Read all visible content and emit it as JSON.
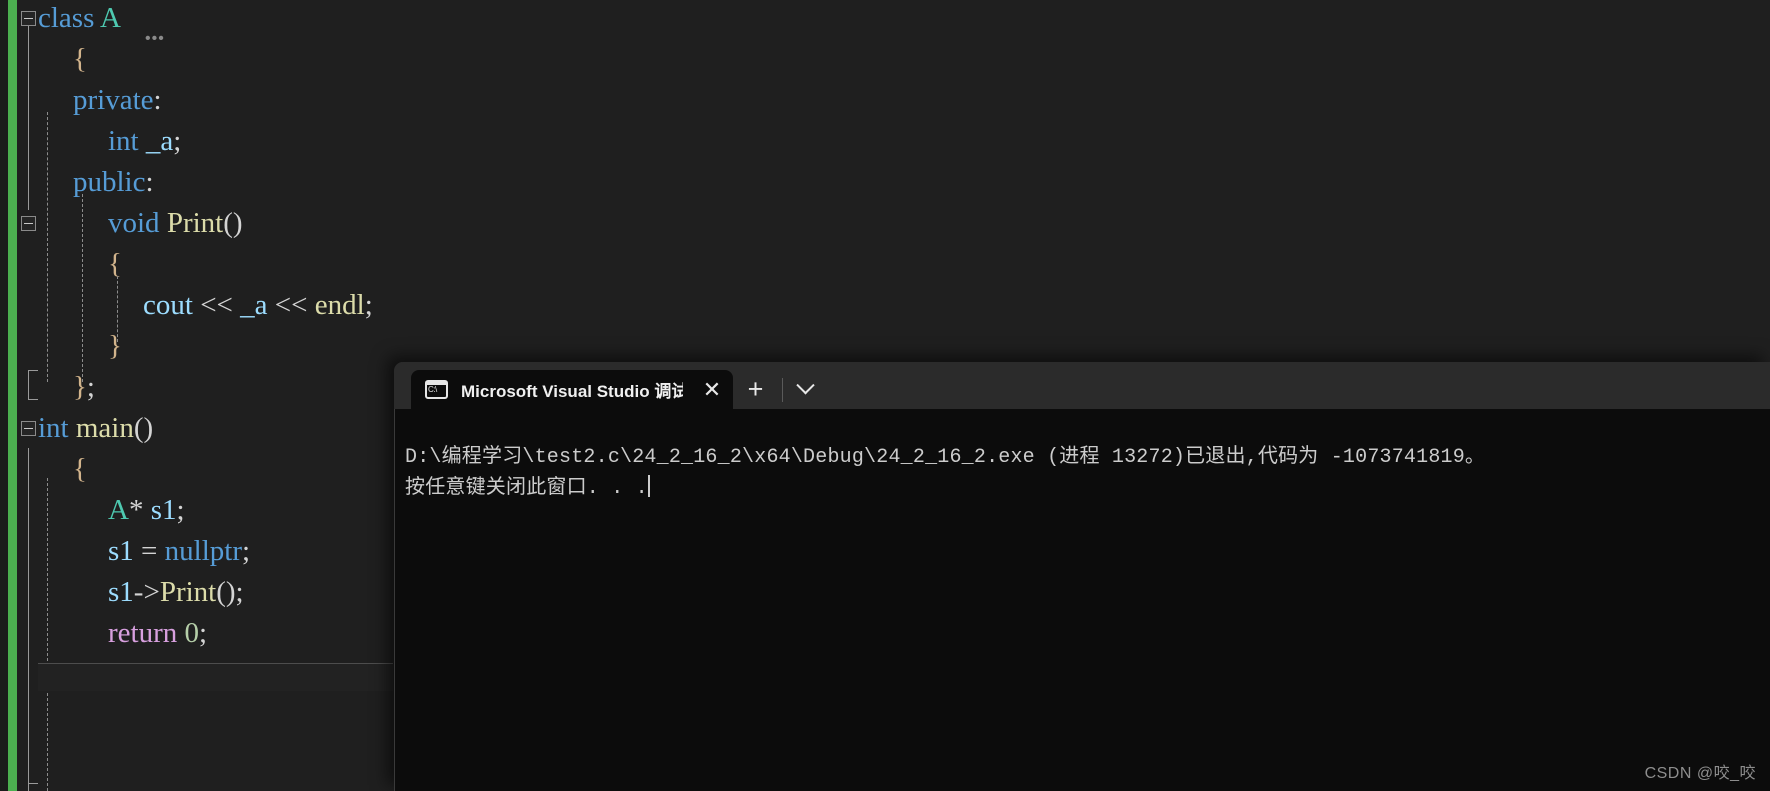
{
  "editor": {
    "language": "cpp",
    "change_bar_color": "#4caf50",
    "background": "#1f1f1f",
    "lines": [
      {
        "indent": 0,
        "fold": true,
        "tokens": [
          {
            "t": "class",
            "c": "kw"
          },
          {
            "t": " ",
            "c": "plain"
          },
          {
            "t": "A",
            "c": "type"
          }
        ]
      },
      {
        "indent": 1,
        "fold": false,
        "tokens": [
          {
            "t": "{",
            "c": "brace"
          }
        ]
      },
      {
        "indent": 1,
        "fold": false,
        "tokens": [
          {
            "t": "private",
            "c": "kw"
          },
          {
            "t": ":",
            "c": "punct"
          }
        ]
      },
      {
        "indent": 2,
        "fold": false,
        "tokens": [
          {
            "t": "int",
            "c": "kw"
          },
          {
            "t": " ",
            "c": "plain"
          },
          {
            "t": "_a",
            "c": "var"
          },
          {
            "t": ";",
            "c": "punct"
          }
        ]
      },
      {
        "indent": 1,
        "fold": false,
        "tokens": [
          {
            "t": "public",
            "c": "kw"
          },
          {
            "t": ":",
            "c": "punct"
          }
        ]
      },
      {
        "indent": 2,
        "fold": true,
        "tokens": [
          {
            "t": "void",
            "c": "kw"
          },
          {
            "t": " ",
            "c": "plain"
          },
          {
            "t": "Print",
            "c": "fn"
          },
          {
            "t": "()",
            "c": "punct"
          }
        ]
      },
      {
        "indent": 2,
        "fold": false,
        "tokens": [
          {
            "t": "{",
            "c": "brace"
          }
        ]
      },
      {
        "indent": 3,
        "fold": false,
        "tokens": [
          {
            "t": "cout",
            "c": "var"
          },
          {
            "t": " ",
            "c": "plain"
          },
          {
            "t": "<<",
            "c": "op"
          },
          {
            "t": " ",
            "c": "plain"
          },
          {
            "t": "_a",
            "c": "var"
          },
          {
            "t": " ",
            "c": "plain"
          },
          {
            "t": "<<",
            "c": "op"
          },
          {
            "t": " ",
            "c": "plain"
          },
          {
            "t": "endl",
            "c": "fn"
          },
          {
            "t": ";",
            "c": "punct"
          }
        ]
      },
      {
        "indent": 2,
        "fold": false,
        "tokens": [
          {
            "t": "}",
            "c": "brace"
          }
        ]
      },
      {
        "indent": 1,
        "fold": false,
        "tokens": [
          {
            "t": "}",
            "c": "brace"
          },
          {
            "t": ";",
            "c": "punct"
          }
        ]
      },
      {
        "indent": 0,
        "fold": true,
        "tokens": [
          {
            "t": "int",
            "c": "kw"
          },
          {
            "t": " ",
            "c": "plain"
          },
          {
            "t": "main",
            "c": "fn"
          },
          {
            "t": "()",
            "c": "punct"
          }
        ]
      },
      {
        "indent": 1,
        "fold": false,
        "tokens": [
          {
            "t": "{",
            "c": "brace"
          }
        ]
      },
      {
        "indent": 2,
        "fold": false,
        "tokens": [
          {
            "t": "A",
            "c": "type"
          },
          {
            "t": "*",
            "c": "plain"
          },
          {
            "t": " ",
            "c": "plain"
          },
          {
            "t": "s1",
            "c": "var"
          },
          {
            "t": ";",
            "c": "punct"
          }
        ]
      },
      {
        "indent": 2,
        "fold": false,
        "tokens": [
          {
            "t": "s1",
            "c": "var"
          },
          {
            "t": " ",
            "c": "plain"
          },
          {
            "t": "=",
            "c": "op"
          },
          {
            "t": " ",
            "c": "plain"
          },
          {
            "t": "nullptr",
            "c": "kw"
          },
          {
            "t": ";",
            "c": "punct"
          }
        ]
      },
      {
        "indent": 2,
        "fold": false,
        "tokens": [
          {
            "t": "s1",
            "c": "var"
          },
          {
            "t": "->",
            "c": "op"
          },
          {
            "t": "Print",
            "c": "fn"
          },
          {
            "t": "()",
            "c": "punct"
          },
          {
            "t": ";",
            "c": "punct"
          }
        ]
      },
      {
        "indent": 2,
        "fold": false,
        "tokens": [
          {
            "t": "return",
            "c": "ctrl"
          },
          {
            "t": " ",
            "c": "plain"
          },
          {
            "t": "0",
            "c": "num"
          },
          {
            "t": ";",
            "c": "punct"
          }
        ]
      },
      {
        "indent": 1,
        "fold": false,
        "tokens": [
          {
            "t": "}",
            "c": "brace"
          }
        ]
      }
    ]
  },
  "console": {
    "tab": {
      "icon": "console-cmd-icon",
      "icon_label": "C:\\",
      "title": "Microsoft Visual Studio 调试控",
      "close_label": "✕"
    },
    "new_tab_label": "+",
    "dropdown_label": "⌄",
    "output_lines": [
      "D:\\编程学习\\test2.c\\24_2_16_2\\x64\\Debug\\24_2_16_2.exe (进程 13272)已退出,代码为 -1073741819。",
      "按任意键关闭此窗口. . ."
    ],
    "exit_code": "-1073741819",
    "process_id": "13272",
    "executable_path": "D:\\编程学习\\test2.c\\24_2_16_2\\x64\\Debug\\24_2_16_2.exe",
    "background": "#0c0c0c",
    "text_color": "#cccccc"
  },
  "watermark": {
    "text": "CSDN @咬_咬"
  }
}
